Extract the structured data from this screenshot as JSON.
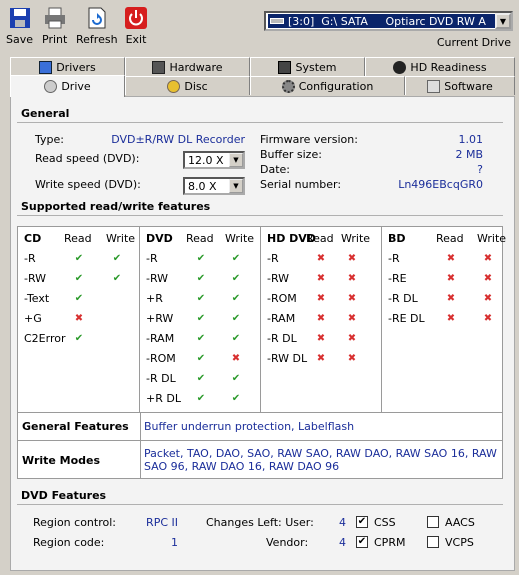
{
  "toolbar": {
    "save": "Save",
    "print": "Print",
    "refresh": "Refresh",
    "exit": "Exit"
  },
  "drive_select": "[3:0]  G:\\ SATA     Optiarc DVD RW A",
  "current_drive": "Current Drive",
  "tabs_row1": [
    "Drivers",
    "Hardware",
    "System",
    "HD Readiness"
  ],
  "tabs_row2": [
    "Drive",
    "Disc",
    "Configuration",
    "Software"
  ],
  "general": {
    "heading": "General",
    "type_label": "Type:",
    "type_value": "DVD±R/RW DL Recorder",
    "read_speed_label": "Read speed (DVD):",
    "read_speed_value": "12.0 X",
    "write_speed_label": "Write speed (DVD):",
    "write_speed_value": "8.0 X",
    "firmware_label": "Firmware version:",
    "firmware_value": "1.01",
    "buffer_label": "Buffer size:",
    "buffer_value": "2 MB",
    "date_label": "Date:",
    "date_value": "?",
    "serial_label": "Serial number:",
    "serial_value": "Ln496EBcqGR0"
  },
  "features": {
    "heading": "Supported read/write features",
    "read": "Read",
    "write": "Write",
    "cd": {
      "title": "CD",
      "items": [
        [
          "-R",
          1,
          1
        ],
        [
          "-RW",
          1,
          1
        ],
        [
          "-Text",
          1,
          null
        ],
        [
          "+G",
          0,
          null
        ],
        [
          "C2Error",
          1,
          null
        ]
      ]
    },
    "dvd": {
      "title": "DVD",
      "items": [
        [
          "-R",
          1,
          1
        ],
        [
          "-RW",
          1,
          1
        ],
        [
          "+R",
          1,
          1
        ],
        [
          "+RW",
          1,
          1
        ],
        [
          "-RAM",
          1,
          1
        ],
        [
          "-ROM",
          1,
          0
        ],
        [
          "-R DL",
          1,
          1
        ],
        [
          "+R DL",
          1,
          1
        ]
      ]
    },
    "hddvd": {
      "title": "HD DVD",
      "items": [
        [
          "-R",
          0,
          0
        ],
        [
          "-RW",
          0,
          0
        ],
        [
          "-ROM",
          0,
          0
        ],
        [
          "-RAM",
          0,
          0
        ],
        [
          "-R DL",
          0,
          0
        ],
        [
          "-RW DL",
          0,
          0
        ]
      ]
    },
    "bd": {
      "title": "BD",
      "items": [
        [
          "-R",
          0,
          0
        ],
        [
          "-RE",
          0,
          0
        ],
        [
          "-R DL",
          0,
          0
        ],
        [
          "-RE DL",
          0,
          0
        ]
      ]
    }
  },
  "general_features": {
    "label": "General Features",
    "value": "Buffer underrun protection, Labelflash"
  },
  "write_modes": {
    "label": "Write Modes",
    "value": "Packet, TAO, DAO, SAO, RAW SAO, RAW DAO, RAW SAO 16, RAW SAO 96, RAW DAO 16, RAW DAO 96"
  },
  "dvd_features": {
    "heading": "DVD Features",
    "region_control_label": "Region control:",
    "region_control_value": "RPC II",
    "region_code_label": "Region code:",
    "region_code_value": "1",
    "changes_user_label": "Changes Left: User:",
    "changes_user_value": "4",
    "vendor_label": "Vendor:",
    "vendor_value": "4",
    "css": {
      "label": "CSS",
      "checked": true
    },
    "cprm": {
      "label": "CPRM",
      "checked": true
    },
    "aacs": {
      "label": "AACS",
      "checked": false
    },
    "vcps": {
      "label": "VCPS",
      "checked": false
    }
  },
  "check_glyph": "✔",
  "cross_glyph": "✖",
  "colors": {
    "value_blue": "#1b2e9a",
    "ok": "#2b9a2b",
    "no": "#d83030"
  }
}
